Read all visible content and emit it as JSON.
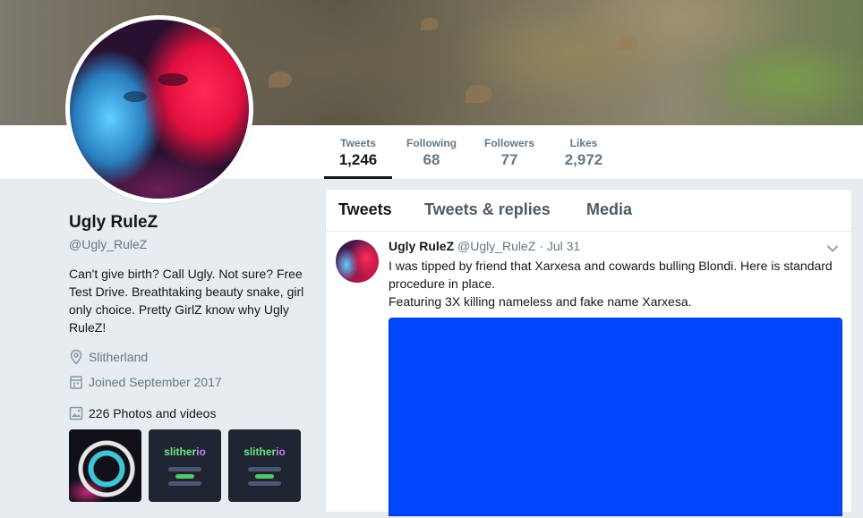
{
  "stats": [
    {
      "label": "Tweets",
      "value": "1,246"
    },
    {
      "label": "Following",
      "value": "68"
    },
    {
      "label": "Followers",
      "value": "77"
    },
    {
      "label": "Likes",
      "value": "2,972"
    }
  ],
  "profile": {
    "name": "Ugly RuleZ",
    "handle": "@Ugly_RuleZ",
    "bio": "Can't give birth? Call Ugly. Not sure? Free Test Drive. Breathtaking beauty snake, girl only choice. Pretty GirlZ know why Ugly RuleZ!",
    "location": "Slitherland",
    "joined": "Joined September 2017",
    "media_count": "226 Photos and videos",
    "thumbs": [
      {
        "icon": "snake-art-thumbnail"
      },
      {
        "icon": "slither-io-thumbnail",
        "logo_a": "slither",
        "logo_b": "io"
      },
      {
        "icon": "slither-io-thumbnail",
        "logo_a": "slither",
        "logo_b": "io"
      }
    ]
  },
  "timeline": {
    "tabs": [
      "Tweets",
      "Tweets & replies",
      "Media"
    ],
    "tweet": {
      "name": "Ugly RuleZ",
      "handle": "@Ugly_RuleZ",
      "dot": "·",
      "date": "Jul 31",
      "line1": "I was tipped by friend that Xarxesa and cowards bulling Blondi. Here is standard procedure in place.",
      "line2": "Featuring 3X killing nameless and fake name Xarxesa.",
      "media_color": "#0045ff"
    }
  },
  "colors": {
    "accent": "#14171a",
    "muted": "#657786",
    "background": "#e6ecf0"
  }
}
